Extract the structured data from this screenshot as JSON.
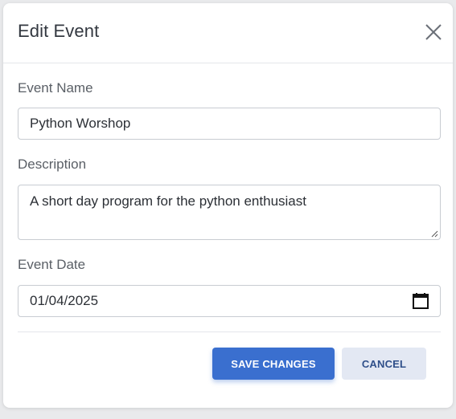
{
  "dialog": {
    "title": "Edit Event",
    "close_icon": "close-icon"
  },
  "form": {
    "event_name": {
      "label": "Event Name",
      "value": "Python Worshop"
    },
    "description": {
      "label": "Description",
      "value": "A short day program for the python enthusiast"
    },
    "event_date": {
      "label": "Event Date",
      "value": "01/04/2025",
      "icon": "calendar-icon"
    }
  },
  "actions": {
    "save_label": "SAVE CHANGES",
    "cancel_label": "CANCEL"
  },
  "colors": {
    "primary": "#3a6fcf",
    "secondary_bg": "#e3e8f3",
    "secondary_text": "#2f4f8a"
  }
}
